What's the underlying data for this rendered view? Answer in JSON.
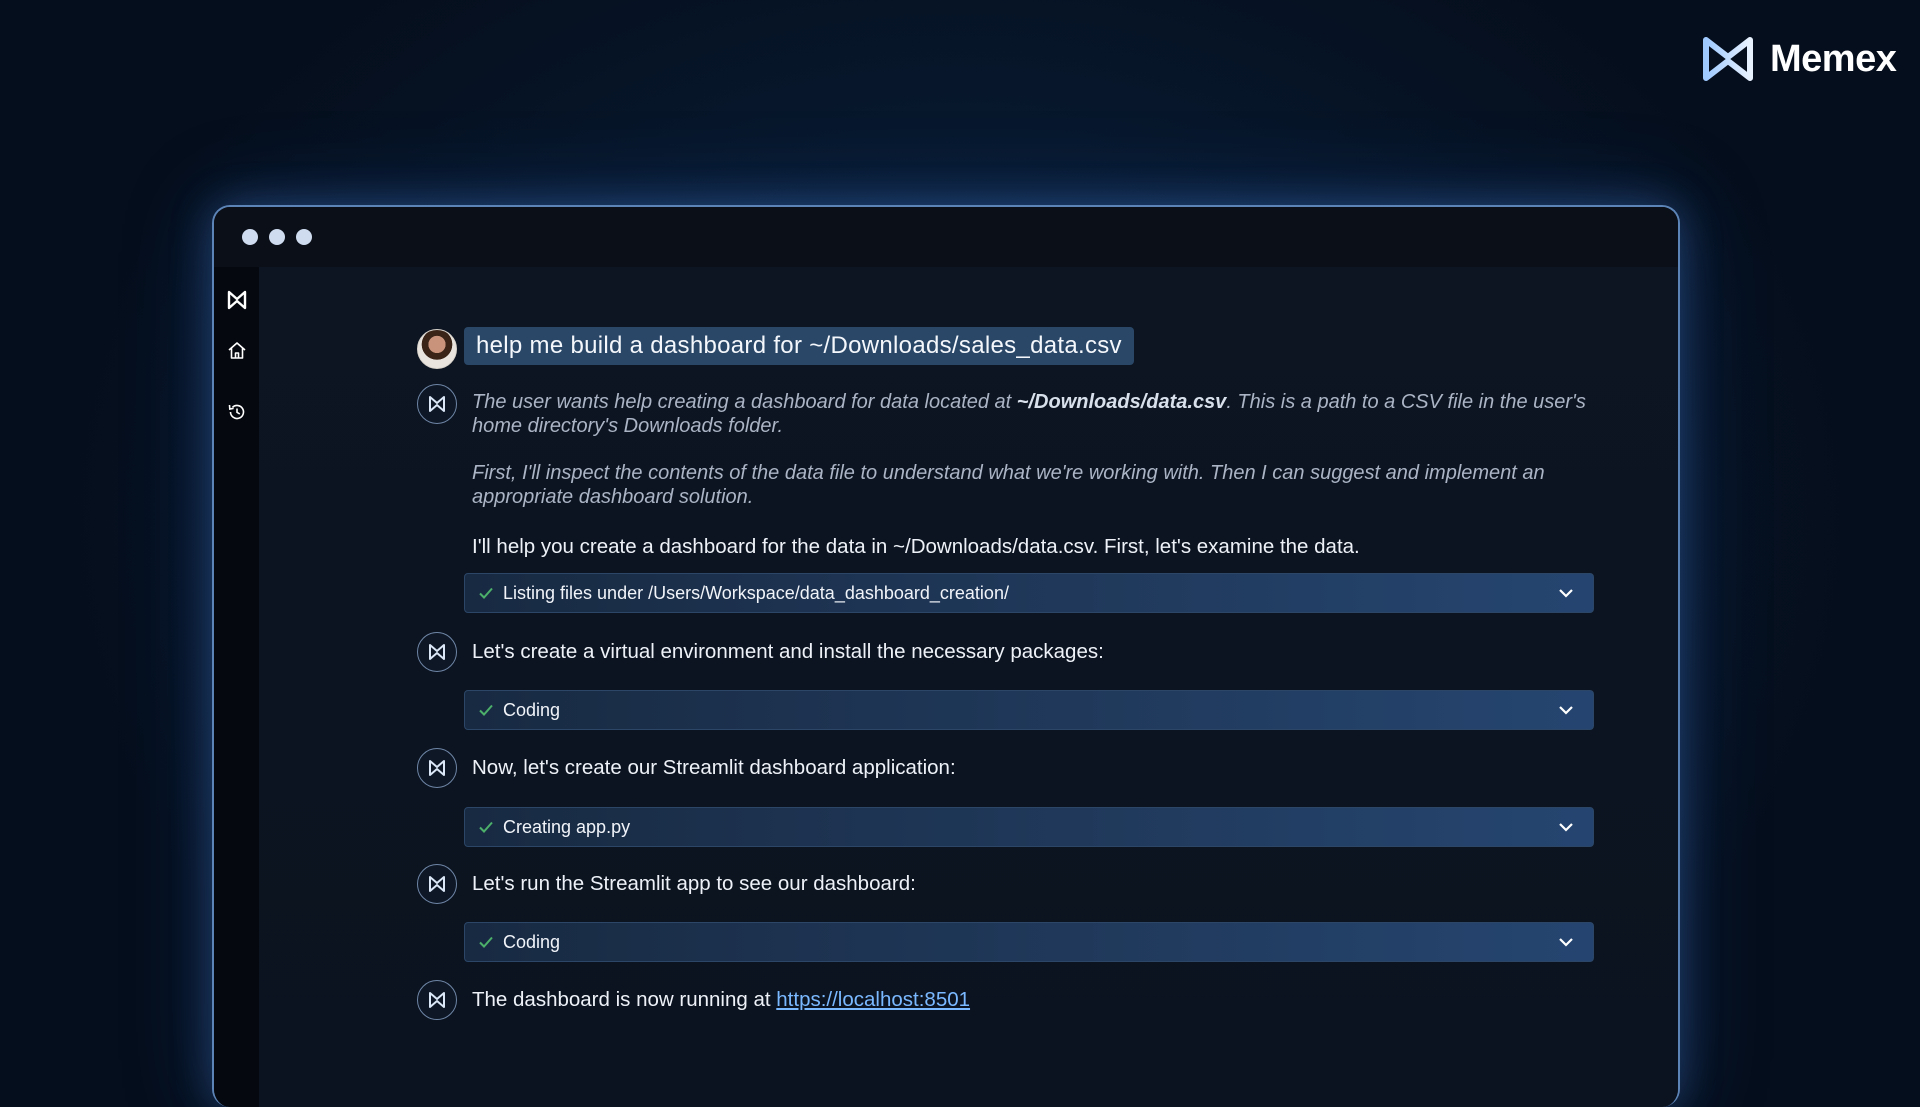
{
  "brand": {
    "name": "Memex",
    "logo_icon": "memex-logo-icon"
  },
  "window": {
    "controls": [
      "dot",
      "dot",
      "dot"
    ]
  },
  "sidebar": {
    "icons": [
      "memex-logo-icon",
      "home-icon",
      "history-icon"
    ]
  },
  "conversation": {
    "user_message": "help me build a dashboard for ~/Downloads/sales_data.csv",
    "thinking": {
      "p1_pre": "The user wants help creating a dashboard for data located at ",
      "p1_bold": "~/Downloads/data.csv",
      "p1_post": ". This is a path to a CSV file in the user's home directory's Downloads folder.",
      "p2": "First, I'll inspect the contents of the data file to understand what we're working with. Then I can suggest and implement an appropriate dashboard solution."
    },
    "reply_1": "I'll help you create a dashboard for the data in ~/Downloads/data.csv. First, let's examine the data.",
    "tool_1": "Listing files under /Users/Workspace/data_dashboard_creation/",
    "msg_2": "Let's create a virtual environment and install the necessary packages:",
    "tool_2": "Coding",
    "msg_3": "Now, let's create our Streamlit dashboard application:",
    "tool_3": "Creating app.py",
    "msg_4": "Let's run the Streamlit app to see our dashboard:",
    "tool_4": "Coding",
    "msg_5_pre": "The dashboard is now running at ",
    "msg_5_link": "https://localhost:8501"
  },
  "colors": {
    "accent": "#7ab8ff",
    "check": "#4caf6a",
    "tool_bg": "#20395b"
  }
}
